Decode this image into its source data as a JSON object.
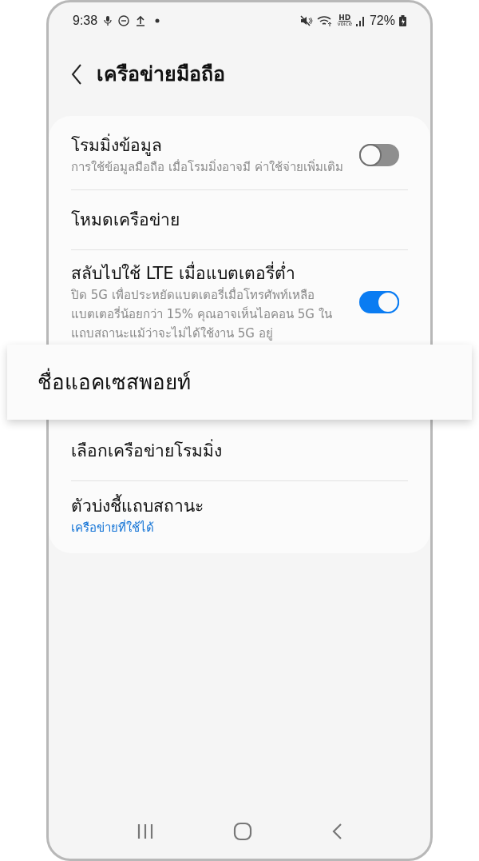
{
  "status_bar": {
    "time": "9:38",
    "hd": "HD",
    "hd_sub": "voice",
    "battery": "72%"
  },
  "header": {
    "title": "เครือข่ายมือถือ"
  },
  "items": [
    {
      "kind": "toggle",
      "title": "โรมมิ่งข้อมูล",
      "subtitle": "การใช้ข้อมูลมือถือ เมื่อโรมมิ่งอาจมี ค่าใช้จ่ายเพิ่มเติม",
      "on": false
    },
    {
      "kind": "plain",
      "title": "โหมดเครือข่าย"
    },
    {
      "kind": "toggle",
      "title": "สลับไปใช้ LTE เมื่อแบตเตอรี่ต่ำ",
      "subtitle": "ปิด 5G เพื่อประหยัดแบตเตอรี่เมื่อโทรศัพท์เหลือแบตเตอรี่น้อยกว่า 15% คุณอาจเห็นไอคอน 5G ในแถบสถานะแม้ว่าจะไม่ได้ใช้งาน 5G อยู่",
      "on": true
    },
    {
      "kind": "highlight",
      "title": "ชื่อแอคเซสพอยท์"
    },
    {
      "kind": "plain",
      "title": "เลือกเครือข่ายโรมมิ่ง"
    },
    {
      "kind": "link",
      "title": "ตัวบ่งชี้แถบสถานะ",
      "subtitle": "เครือข่ายที่ใช้ได้"
    }
  ]
}
